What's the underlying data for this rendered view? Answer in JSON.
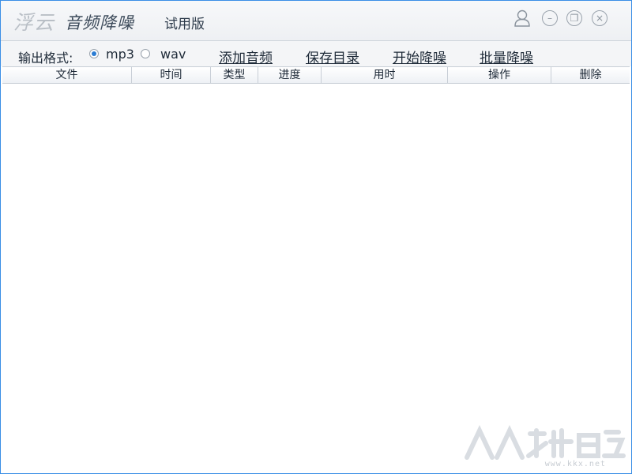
{
  "title_bar": {
    "logo_text": "浮云",
    "app_name": "音频降噪",
    "edition": "试用版",
    "controls": {
      "user_icon": "user-icon",
      "minimize_icon": "minimize-icon",
      "maximize_icon": "restore-icon",
      "close_icon": "close-icon",
      "minimize_glyph": "–",
      "maximize_glyph": "❐",
      "close_glyph": "×"
    }
  },
  "toolbar": {
    "output_format_label": "输出格式:",
    "formats": [
      {
        "label": "mp3",
        "checked": true
      },
      {
        "label": "wav",
        "checked": false
      }
    ],
    "actions": [
      "添加音频",
      "保存目录",
      "开始降噪",
      "批量降噪"
    ]
  },
  "table": {
    "columns": [
      "文件",
      "时间",
      "类型",
      "进度",
      "用时",
      "操作",
      "删除"
    ],
    "rows": []
  },
  "watermark": {
    "text": "www.kkx.net"
  },
  "colors": {
    "window_border": "#3a8ee6",
    "radio_selected": "#2b7cd3",
    "text": "#1e2a38"
  }
}
